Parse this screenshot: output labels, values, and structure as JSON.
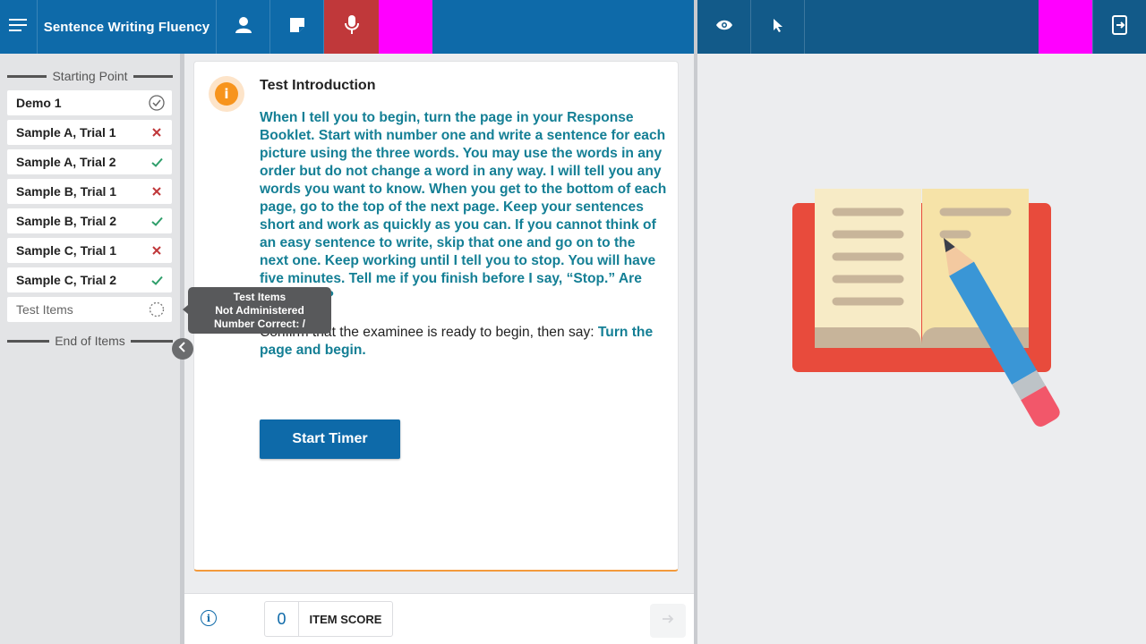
{
  "header": {
    "app_title": "Sentence Writing Fluency",
    "icons": [
      "menu-icon",
      "person-icon",
      "note-icon",
      "microphone-icon",
      "eye-icon",
      "pointer-icon",
      "exit-icon"
    ],
    "colors": {
      "primary": "#0e6aa9",
      "mic_active": "#c0383a",
      "highlight": "#ff00ff"
    }
  },
  "sidebar": {
    "start_label": "Starting Point",
    "end_label": "End of Items",
    "items": [
      {
        "label": "Demo 1",
        "status": "check-circle"
      },
      {
        "label": "Sample A, Trial 1",
        "status": "incorrect"
      },
      {
        "label": "Sample A, Trial 2",
        "status": "correct"
      },
      {
        "label": "Sample B, Trial 1",
        "status": "incorrect"
      },
      {
        "label": "Sample B, Trial 2",
        "status": "correct"
      },
      {
        "label": "Sample C, Trial 1",
        "status": "incorrect"
      },
      {
        "label": "Sample C, Trial 2",
        "status": "correct"
      },
      {
        "label": "Test Items",
        "status": "pending"
      }
    ]
  },
  "tooltip": {
    "line1": "Test Items",
    "line2": "Not Administered",
    "line3": "Number Correct: /"
  },
  "card": {
    "title": "Test Introduction",
    "instructions": "When I tell you to begin, turn the page in your Response Booklet. Start with number one and write a sentence for each picture using the three words. You may use the words in any order but do not change a word in any way. I will tell you any words you want to know. When you get to the bottom of each page, go to the top of the next page. Keep your sentences short and work as quickly as you can. If you cannot think of an easy sentence to write, skip that one and go on to the next one. Keep working until I tell you to stop. You will have five minutes. Tell me if you finish before I say, “Stop.” Are you ready?",
    "confirm_text": "Confirm that the examinee is ready to begin, then say: ",
    "confirm_highlight": "Turn the page and begin.",
    "start_button": "Start Timer"
  },
  "footer": {
    "item_score_value": "0",
    "item_score_label": "ITEM SCORE"
  }
}
